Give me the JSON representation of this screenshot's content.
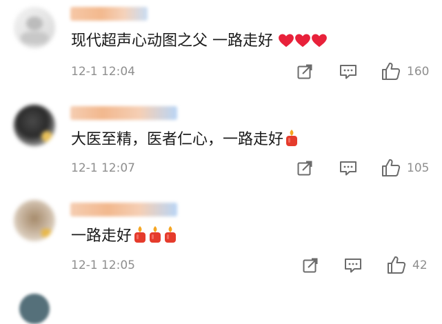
{
  "comments": [
    {
      "text": "现代超声心动图之父 一路走好",
      "emoji": [
        "heart",
        "heart",
        "heart"
      ],
      "time": "12-1 12:04",
      "likes": "160"
    },
    {
      "text": "大医至精，医者仁心，一路走好",
      "emoji": [
        "candle"
      ],
      "time": "12-1 12:07",
      "likes": "105"
    },
    {
      "text": "一路走好",
      "emoji": [
        "candle",
        "candle",
        "candle"
      ],
      "time": "12-1 12:05",
      "likes": "42"
    }
  ],
  "colors": {
    "text": "#1a1a1a",
    "meta": "#8e8e8e",
    "heart": "#e8213a",
    "candle": "#e53b2c",
    "flame": "#f5a623"
  }
}
